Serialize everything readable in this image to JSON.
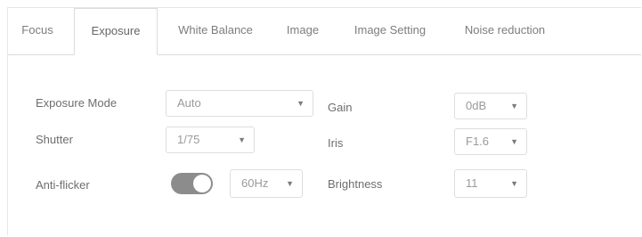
{
  "tabs": [
    {
      "label": "Focus"
    },
    {
      "label": "Exposure",
      "active": true
    },
    {
      "label": "White Balance"
    },
    {
      "label": "Image"
    },
    {
      "label": "Image Setting"
    },
    {
      "label": "Noise reduction"
    }
  ],
  "exposure": {
    "mode_label": "Exposure Mode",
    "mode_value": "Auto",
    "shutter_label": "Shutter",
    "shutter_value": "1/75",
    "antiflicker_label": "Anti-flicker",
    "antiflicker_on": true,
    "antiflicker_freq": "60Hz",
    "gain_label": "Gain",
    "gain_value": "0dB",
    "iris_label": "Iris",
    "iris_value": "F1.6",
    "brightness_label": "Brightness",
    "brightness_value": "11"
  },
  "icons": {
    "dropdown": "caret-down-icon"
  },
  "colors": {
    "toggle_on": "#8c8c8c",
    "border": "#dedede"
  }
}
